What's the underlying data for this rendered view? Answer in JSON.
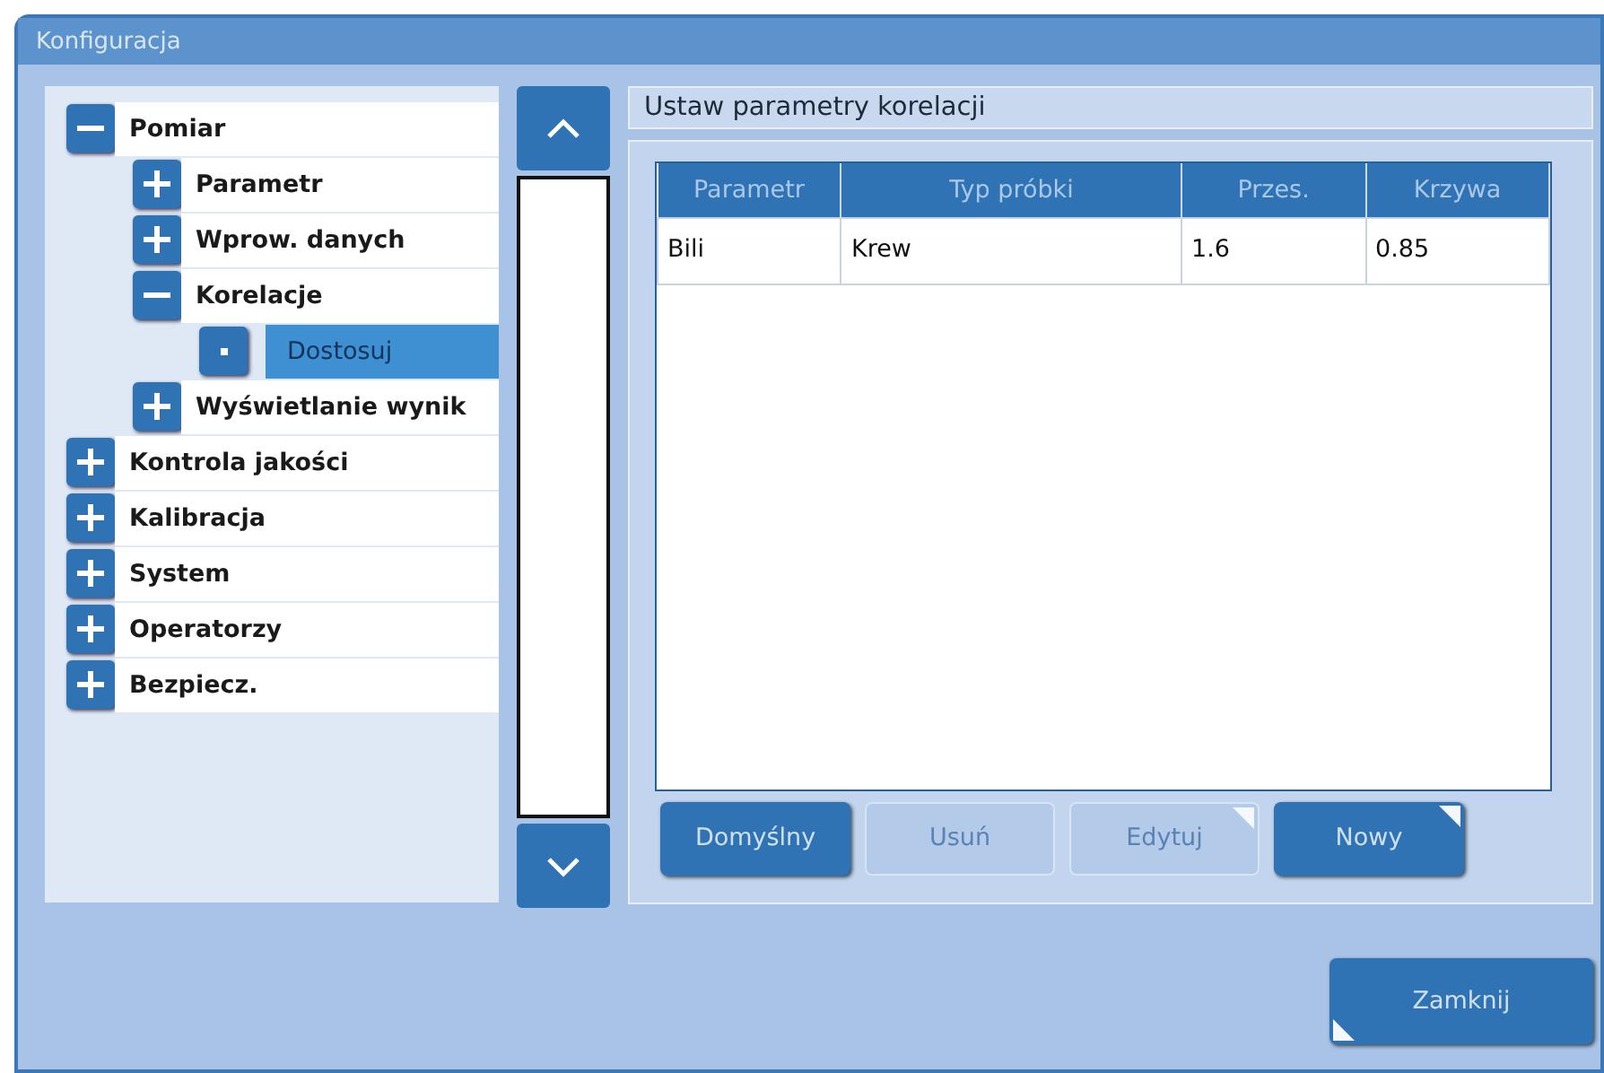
{
  "window": {
    "title": "Konfiguracja"
  },
  "tree": [
    {
      "label": "Pomiar",
      "kind": "branch",
      "expanded": true,
      "selected": false,
      "children": [
        {
          "label": "Parametr",
          "kind": "branch",
          "expanded": false,
          "selected": false
        },
        {
          "label": "Wprow. danych",
          "kind": "branch",
          "expanded": false,
          "selected": false
        },
        {
          "label": "Korelacje",
          "kind": "branch",
          "expanded": true,
          "selected": false,
          "children": [
            {
              "label": "Dostosuj",
              "kind": "leaf",
              "selected": true
            }
          ]
        },
        {
          "label": "Wyświetlanie wynik",
          "kind": "branch",
          "expanded": false,
          "selected": false
        }
      ]
    },
    {
      "label": "Kontrola jakości",
      "kind": "branch",
      "expanded": false,
      "selected": false
    },
    {
      "label": "Kalibracja",
      "kind": "branch",
      "expanded": false,
      "selected": false
    },
    {
      "label": "System",
      "kind": "branch",
      "expanded": false,
      "selected": false
    },
    {
      "label": "Operatorzy",
      "kind": "branch",
      "expanded": false,
      "selected": false
    },
    {
      "label": "Bezpiecz.",
      "kind": "branch",
      "expanded": false,
      "selected": false
    }
  ],
  "panel": {
    "title": "Ustaw parametry korelacji",
    "table": {
      "columns": [
        "Parametr",
        "Typ próbki",
        "Przes.",
        "Krzywa"
      ],
      "rows": [
        [
          "Bili",
          "Krew",
          "1.6",
          "0.85"
        ]
      ]
    },
    "buttons": [
      {
        "label": "Domyślny",
        "disabled": false
      },
      {
        "label": "Usuń",
        "disabled": true
      },
      {
        "label": "Edytuj",
        "disabled": true,
        "corner_mark": true
      },
      {
        "label": "Nowy",
        "disabled": false,
        "corner_mark": true
      }
    ]
  },
  "footer_buttons": [
    {
      "label": "Zamknij",
      "disabled": false,
      "corner_mark": true
    }
  ]
}
